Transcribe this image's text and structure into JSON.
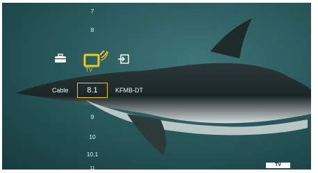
{
  "channels_above": [
    "7",
    "8"
  ],
  "nav_icons": {
    "left": "toolbox-icon",
    "center": "tv-antenna-icon",
    "right": "input-icon",
    "center_label": "TV"
  },
  "tuner": {
    "source_label": "Cable",
    "current_channel": "8.1",
    "station_name": "KFMB-DT"
  },
  "channels_below": [
    "9",
    "10",
    "10.1",
    "11"
  ],
  "badge": "TV",
  "colors": {
    "accent": "#f2c61f",
    "text": "#f1f5f5"
  }
}
